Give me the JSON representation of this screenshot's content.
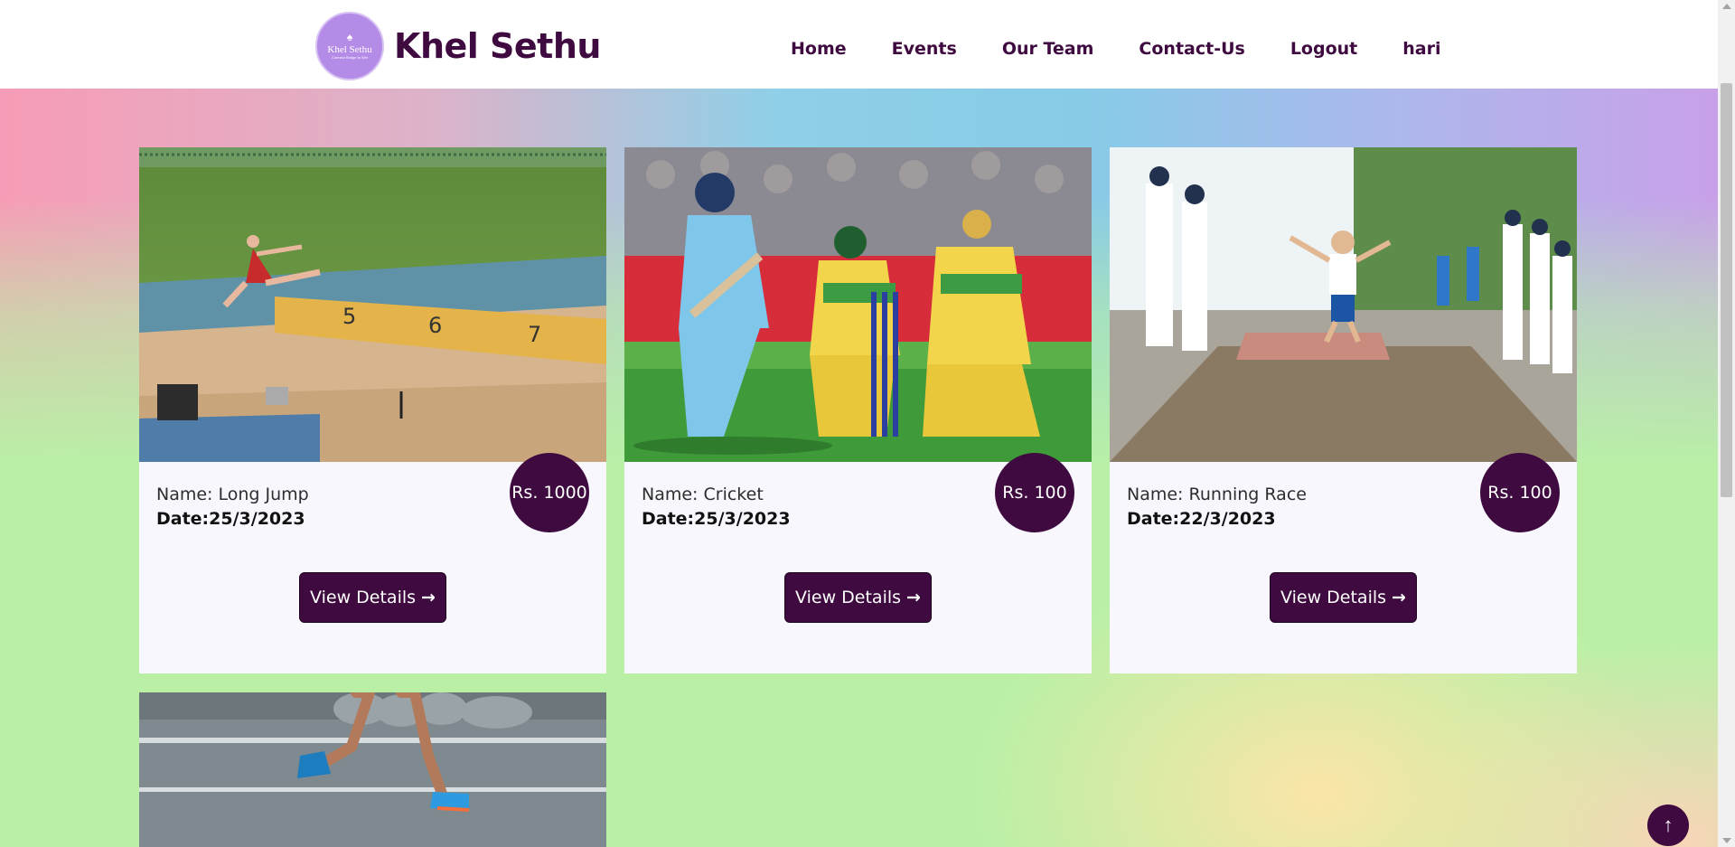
{
  "brand": {
    "name": "Khel Sethu",
    "logo_text": "Khel Sethu",
    "logo_tagline": "Connect Bridge to Win"
  },
  "nav": {
    "links": [
      "Home",
      "Events",
      "Our Team",
      "Contact-Us",
      "Logout",
      "hari"
    ]
  },
  "events": [
    {
      "name": "Name: Long Jump",
      "date": "Date:25/3/2023",
      "price": "Rs. 1000",
      "button": "View Details",
      "image": "long-jump-athlete-photo"
    },
    {
      "name": "Name: Cricket",
      "date": "Date:25/3/2023",
      "price": "Rs. 100",
      "button": "View Details",
      "image": "cricket-batsman-photo"
    },
    {
      "name": "Name: Running Race",
      "date": "Date:22/3/2023",
      "price": "Rs. 100",
      "button": "View Details",
      "image": "school-long-jump-photo"
    },
    {
      "image": "running-legs-photo"
    }
  ],
  "icons": {
    "arrow": "arrow-right-icon",
    "scroll_top": "arrow-up-icon"
  },
  "colors": {
    "primary": "#3e0a3f",
    "card_bg": "#f8f7fe",
    "logo_bg": "#b58be8"
  }
}
